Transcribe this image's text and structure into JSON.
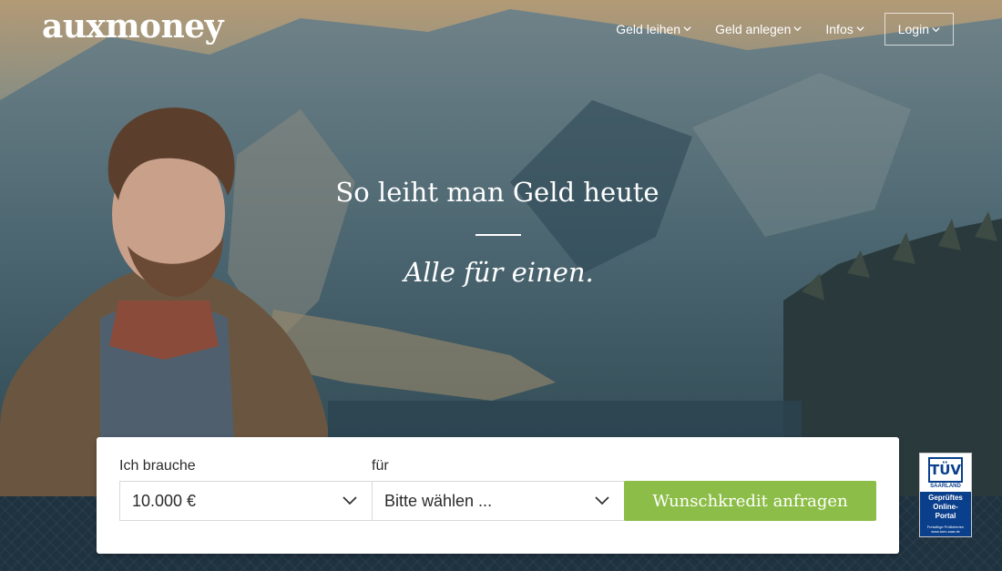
{
  "header": {
    "logo": "auxmoney",
    "nav": [
      {
        "label": "Geld leihen"
      },
      {
        "label": "Geld anlegen"
      },
      {
        "label": "Infos"
      }
    ],
    "login_label": "Login"
  },
  "hero": {
    "headline": "So leiht man Geld heute",
    "tagline": "Alle für einen."
  },
  "form": {
    "amount_label": "Ich brauche",
    "amount_value": "10.000 €",
    "purpose_label": "für",
    "purpose_value": "Bitte wählen ...",
    "submit_label": "Wunschkredit anfragen"
  },
  "badge": {
    "logo": "TÜV",
    "region": "SAARLAND",
    "line1": "Geprüftes",
    "line2": "Online-",
    "line3": "Portal",
    "small": "Freiwillige Prüfkriterien www.tuev-saar.de"
  },
  "colors": {
    "accent_green": "#8cbd48",
    "tuv_blue": "#0a3f8c"
  }
}
